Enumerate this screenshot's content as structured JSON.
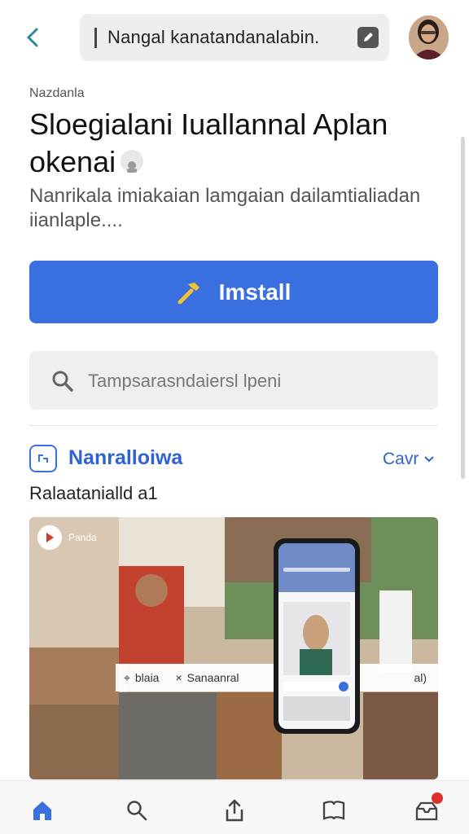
{
  "header": {
    "url_text": "Nangal kanatandanalabin."
  },
  "page": {
    "eyebrow": "Nazdanla",
    "title_line1": "Sloegialani Iuallannal Aplan",
    "title_line2": "okenai",
    "description": "Nanrikala imiakaian lamgaian dailamtialiadan iianlaple...."
  },
  "install_button": {
    "label": "Imstall"
  },
  "search": {
    "placeholder": "Tampsarasndaiersl lpeni"
  },
  "section": {
    "title": "Nanralloiwa",
    "more_label": "Cavr",
    "subtitle": "Ralaatanialld a1"
  },
  "media": {
    "play_label": "Panda",
    "chip_left": "blaia",
    "chip_mid": "Sanaanral",
    "chip_right": "al)"
  },
  "colors": {
    "accent": "#3a6fe0",
    "accent_text": "#2f62d6",
    "badge": "#e0302a"
  },
  "icons": {
    "back": "chevron-left-icon",
    "edit": "edit-icon",
    "install": "hammer-icon",
    "search": "search-icon",
    "section": "app-grid-icon",
    "more": "chevron-down-icon",
    "nav": [
      "home-icon",
      "search-icon",
      "share-icon",
      "bookmark-icon",
      "inbox-icon"
    ]
  }
}
